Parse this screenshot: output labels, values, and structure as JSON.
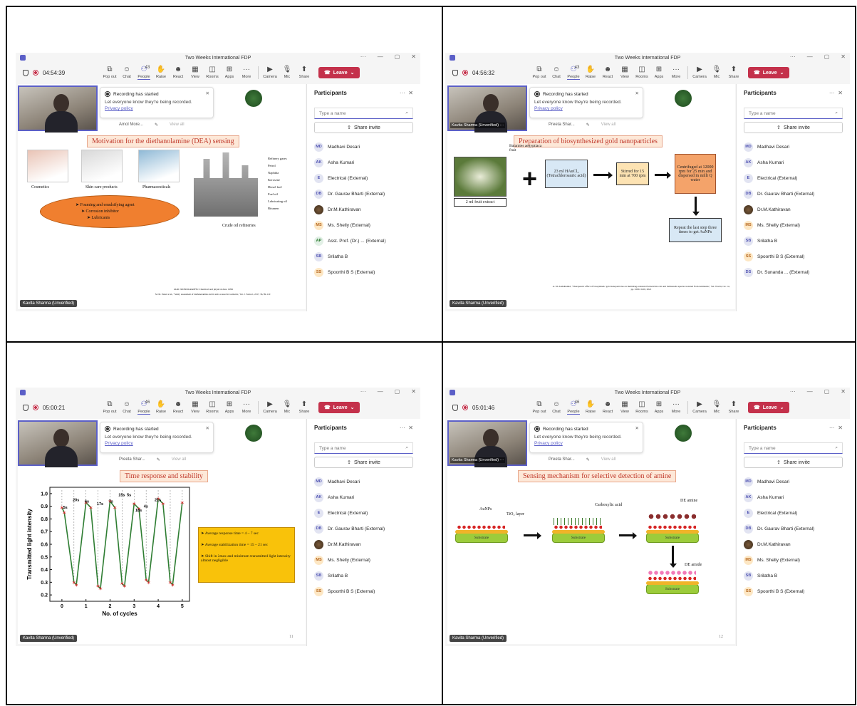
{
  "panes": [
    {
      "window_title": "Two Weeks International FDP",
      "timer": "04:54:39",
      "people_count": "43",
      "notice": {
        "title": "Recording has started",
        "desc": "Let everyone know they're being recorded.",
        "link": "Privacy policy"
      },
      "peek": [
        "Amol More...",
        "View all"
      ],
      "slide_title": "Motivation for the diethanolamine (DEA) sensing",
      "presenter": "Kavita Sharma (Unverified)",
      "slide1": {
        "products": [
          "Cosmetics",
          "Skin care products",
          "Pharmaceuticals"
        ],
        "uses": [
          "Foaming and emulsifying agent",
          "Corrosion inhibitor",
          "Lubricants"
        ],
        "refinery_label": "Crude oil refineries",
        "refinery_outputs": [
          "Refinery gases",
          "Petrol",
          "Naphtha",
          "Kerosene",
          "Diesel fuel",
          "Fuel oil",
          "Lubricating oil",
          "Bitumen"
        ],
        "footer1": "IARC MONOGRAPHS: Chemical and physical data. 1999",
        "footer2": "M. M. Paneri et al., \"Safety assessment of diethanolamine and its salts as used in cosmetics,\" Int. J. Toxicol., 2017, 36, 89–110"
      },
      "participants": [
        {
          "initials": "MD",
          "name": "Madhavi Desari"
        },
        {
          "initials": "AK",
          "name": "Asha Kumari"
        },
        {
          "initials": "E",
          "name": "Electrical (External)"
        },
        {
          "initials": "DB",
          "name": "Dr. Gaurav Bharti (External)"
        },
        {
          "initials": "",
          "name": "Dr.M.Kathiravan"
        },
        {
          "initials": "MS",
          "name": "Ms. Shelly (External)"
        },
        {
          "initials": "AP",
          "name": "Asst. Prof. (Dr.) ... (External)"
        },
        {
          "initials": "SB",
          "name": "Srilatha B"
        },
        {
          "initials": "SS",
          "name": "Spoorthi B S (External)"
        }
      ]
    },
    {
      "window_title": "Two Weeks International FDP",
      "timer": "04:56:32",
      "people_count": "43",
      "notice": {
        "title": "Recording has started",
        "desc": "Let everyone know they're being recorded.",
        "link": "Privacy policy"
      },
      "peek": [
        "Preeta Shar...",
        "View all"
      ],
      "video_tag": "Kavita Sharma (Unverified) ···",
      "slide_title": "Preparation of biosynthesized gold nanoparticles",
      "presenter": "Kavita Sharma (Unverified)",
      "slide2": {
        "fruit": "Balanites aegyptiaca fruit",
        "extract": "2 ml fruit extract",
        "reagent": "23 ml HAuCl₄ (Tetrachloroauric acid)",
        "stir": "Stirred for 15 min at 700 rpm",
        "centrifuge": "Centrifuged at 12000 rpm for 25 min and dispersed in milli Q water",
        "repeat": "Repeat the last step three times to get AuNPs",
        "footer": "A. M. Abdelhamid, \"Therapeutic effect of biosynthetic gold nanoparticles on multidrug-resistant Escherichia coli and Salmonella species isolated from ruminants,\" Vet. World, vol. 14, pp. 3200–3210, 2021"
      },
      "participants": [
        {
          "initials": "MD",
          "name": "Madhavi Desari"
        },
        {
          "initials": "AK",
          "name": "Asha Kumari"
        },
        {
          "initials": "E",
          "name": "Electrical (External)"
        },
        {
          "initials": "DB",
          "name": "Dr. Gaurav Bharti (External)"
        },
        {
          "initials": "",
          "name": "Dr.M.Kathiravan"
        },
        {
          "initials": "MS",
          "name": "Ms. Shelly (External)"
        },
        {
          "initials": "SB",
          "name": "Srilatha B"
        },
        {
          "initials": "SS",
          "name": "Spoorthi B S (External)"
        },
        {
          "initials": "DS",
          "name": "Dr. Sunanda ... (External)"
        }
      ]
    },
    {
      "window_title": "Two Weeks International FDP",
      "timer": "05:00:21",
      "people_count": "46",
      "notice": {
        "title": "Recording has started",
        "desc": "Let everyone know they're being recorded.",
        "link": "Privacy policy"
      },
      "peek": [
        "Preeta Shar...",
        "View all"
      ],
      "slide_title": "Time response and stability",
      "presenter": "Kavita Sharma (Unverified)",
      "slide_number": "11",
      "slide3": {
        "bullets": [
          "Average response time = 4 – 7 sec",
          "Average stabilization time = 15 – 21 sec",
          "Shift in λmax and minimum transmitted light intensity almost negligible"
        ],
        "interval_labels": [
          "5s",
          "20s",
          "6s",
          "17s",
          "7s",
          "15s",
          "5s",
          "18s",
          "4s",
          "21s"
        ]
      },
      "participants": [
        {
          "initials": "MD",
          "name": "Madhavi Desari"
        },
        {
          "initials": "AK",
          "name": "Asha Kumari"
        },
        {
          "initials": "E",
          "name": "Electrical (External)"
        },
        {
          "initials": "DB",
          "name": "Dr. Gaurav Bharti (External)"
        },
        {
          "initials": "",
          "name": "Dr.M.Kathiravan"
        },
        {
          "initials": "MS",
          "name": "Ms. Shelly (External)"
        },
        {
          "initials": "SB",
          "name": "Srilatha B"
        },
        {
          "initials": "SS",
          "name": "Spoorthi B S (External)"
        }
      ]
    },
    {
      "window_title": "Two Weeks International FDP",
      "timer": "05:01:46",
      "people_count": "46",
      "notice": {
        "title": "Recording has started",
        "desc": "Let everyone know they're being recorded.",
        "link": "Privacy policy"
      },
      "peek": [
        "Preeta Shar...",
        "View all"
      ],
      "video_tag": "Kavita Sharma (Unverified) ···",
      "slide_title": "Sensing mechanism for selective detection of amine",
      "presenter": "Kavita Sharma (Unverified)",
      "slide_number": "12",
      "slide4": {
        "aunps": "AuNPs",
        "tio2": "TiO₂ layer",
        "acid": "Carboxylic acid",
        "de_amine": "DE amine",
        "de_amide": "DE amide",
        "substrate": "Substrate"
      },
      "participants": [
        {
          "initials": "MD",
          "name": "Madhavi Desari"
        },
        {
          "initials": "AK",
          "name": "Asha Kumari"
        },
        {
          "initials": "E",
          "name": "Electrical (External)"
        },
        {
          "initials": "DB",
          "name": "Dr. Gaurav Bharti (External)"
        },
        {
          "initials": "",
          "name": "Dr.M.Kathiravan"
        },
        {
          "initials": "MS",
          "name": "Ms. Shelly (External)"
        },
        {
          "initials": "SB",
          "name": "Srilatha B"
        },
        {
          "initials": "SS",
          "name": "Spoorthi B S (External)"
        }
      ]
    }
  ],
  "toolbar": {
    "buttons": [
      "Pop out",
      "Chat",
      "People",
      "Raise",
      "React",
      "View",
      "Rooms",
      "Apps",
      "More",
      "Camera",
      "Mic",
      "Share"
    ],
    "leave": "Leave"
  },
  "panel": {
    "title": "Participants",
    "search_placeholder": "Type a name",
    "share_invite": "Share invite"
  },
  "chart_data": {
    "type": "line",
    "xlabel": "No. of cycles",
    "ylabel": "Transmitted light intensity",
    "xlim": [
      -0.5,
      5.3
    ],
    "ylim": [
      0.15,
      1.05
    ],
    "xticks": [
      0,
      1,
      2,
      3,
      4,
      5
    ],
    "yticks": [
      0.2,
      0.3,
      0.4,
      0.5,
      0.6,
      0.7,
      0.8,
      0.9,
      1.0
    ],
    "series": [
      {
        "color": "#2e7d32",
        "marker_color": "#d32f2f",
        "x": [
          0,
          0.1,
          0.5,
          0.6,
          1.0,
          1.2,
          1.5,
          1.6,
          2.0,
          2.2,
          2.5,
          2.6,
          3.0,
          3.2,
          3.5,
          3.6,
          4.0,
          4.2,
          4.5,
          4.6,
          5.0
        ],
        "y": [
          0.89,
          0.85,
          0.3,
          0.28,
          0.93,
          0.89,
          0.27,
          0.25,
          0.94,
          0.89,
          0.29,
          0.27,
          0.92,
          0.88,
          0.32,
          0.3,
          0.96,
          0.92,
          0.3,
          0.28,
          0.93
        ]
      }
    ]
  }
}
